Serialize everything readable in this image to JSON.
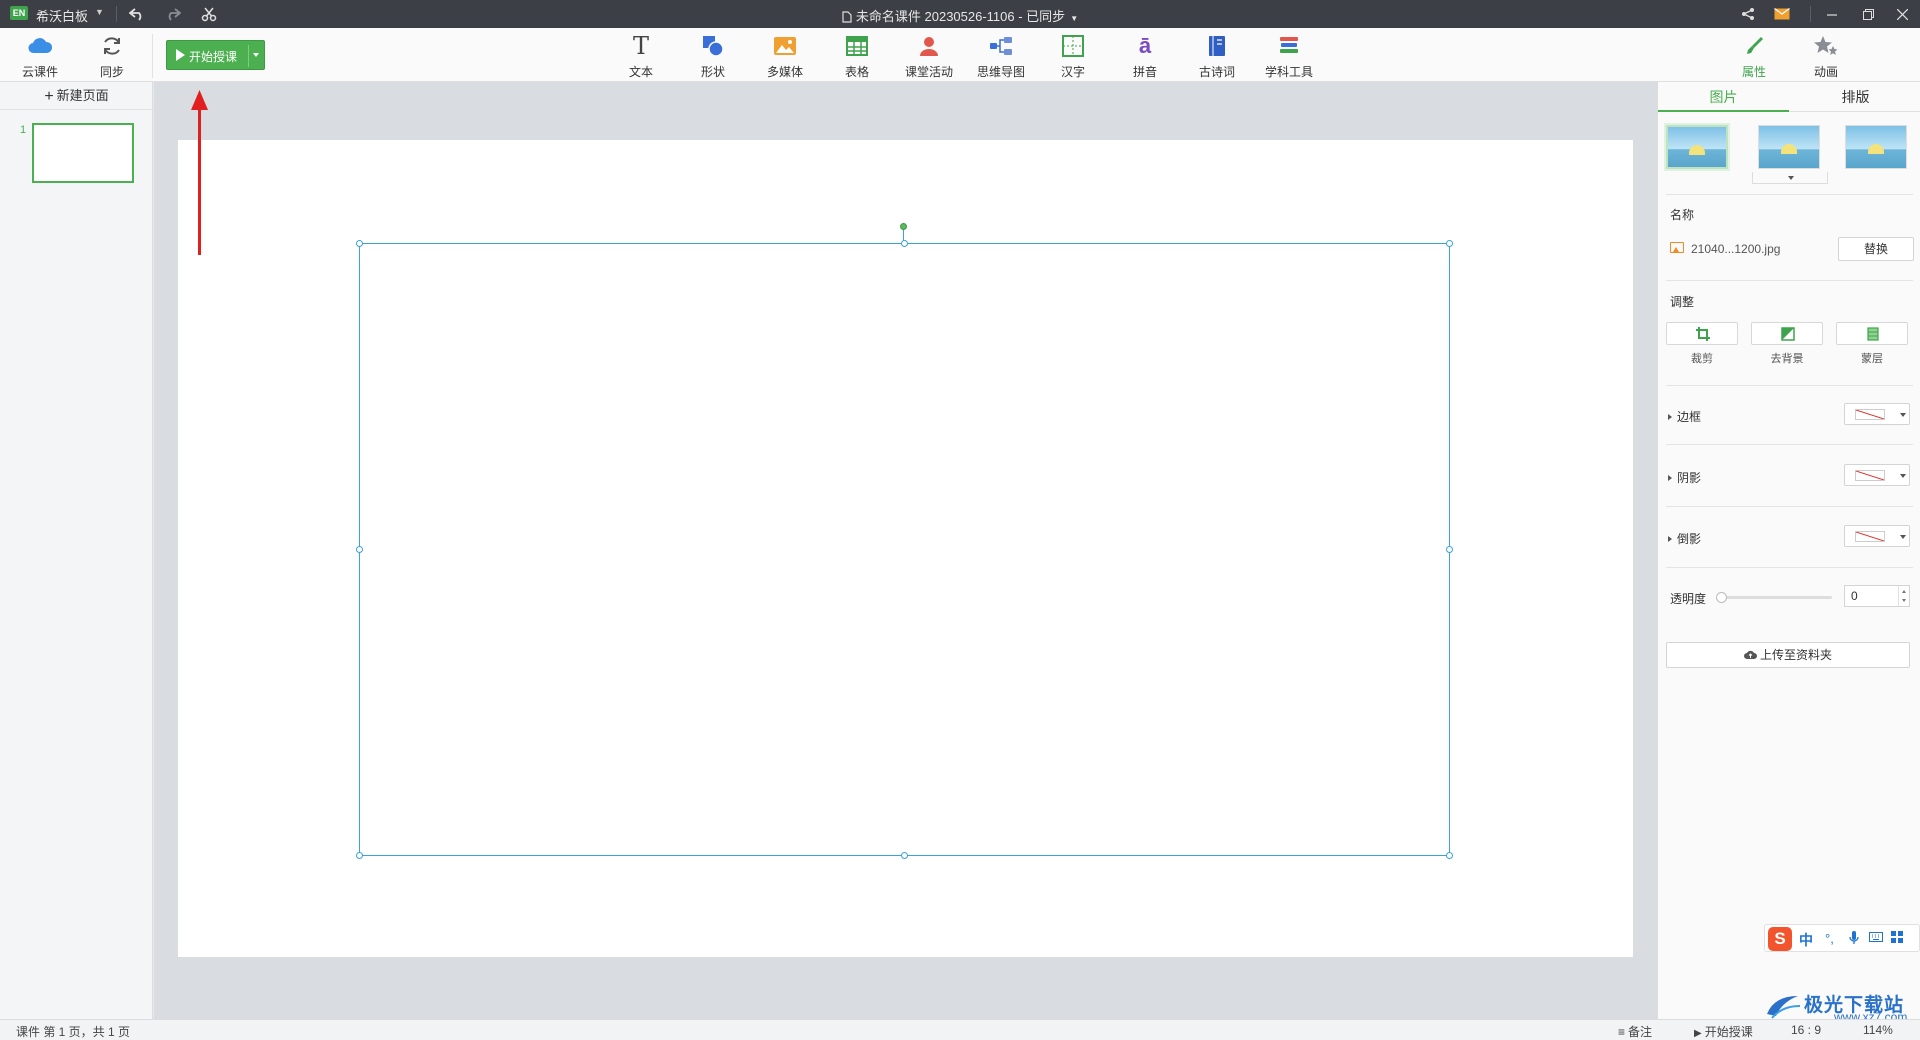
{
  "titlebar": {
    "app_logo": "EN",
    "app_name": "希沃白板",
    "doc_title": "未命名课件 20230526-1106 - 已同步"
  },
  "toolbar": {
    "cloud_label": "云课件",
    "sync_label": "同步",
    "start_label": "开始授课",
    "tools": [
      {
        "label": "文本",
        "icon": "text-icon"
      },
      {
        "label": "形状",
        "icon": "shape-icon"
      },
      {
        "label": "多媒体",
        "icon": "media-icon"
      },
      {
        "label": "表格",
        "icon": "table-icon"
      },
      {
        "label": "课堂活动",
        "icon": "activity-icon"
      },
      {
        "label": "思维导图",
        "icon": "mindmap-icon"
      },
      {
        "label": "汉字",
        "icon": "hanzi-icon"
      },
      {
        "label": "拼音",
        "icon": "pinyin-icon"
      },
      {
        "label": "古诗词",
        "icon": "poem-icon"
      },
      {
        "label": "学科工具",
        "icon": "subject-tools-icon"
      }
    ],
    "properties_label": "属性",
    "animation_label": "动画"
  },
  "left_panel": {
    "new_page_label": "新建页面",
    "slide_number": "1"
  },
  "right_panel": {
    "tabs": [
      "图片",
      "排版"
    ],
    "name_section": "名称",
    "file_name": "21040...1200.jpg",
    "replace_label": "替换",
    "adjust_section": "调整",
    "crop_label": "裁剪",
    "remove_bg_label": "去背景",
    "mask_label": "蒙层",
    "border_label": "边框",
    "shadow_label": "阴影",
    "reflection_label": "倒影",
    "opacity_label": "透明度",
    "opacity_value": "0",
    "upload_label": "上传至资料夹"
  },
  "statusbar": {
    "page_info": "课件 第 1 页，共 1 页",
    "notes_label": "备注",
    "start_label": "开始授课",
    "ratio": "16 : 9",
    "zoom": "114%"
  },
  "ime": {
    "logo": "S",
    "mode": "中"
  },
  "watermark": {
    "text": "极光下载站",
    "url": "www.xz7.com"
  }
}
